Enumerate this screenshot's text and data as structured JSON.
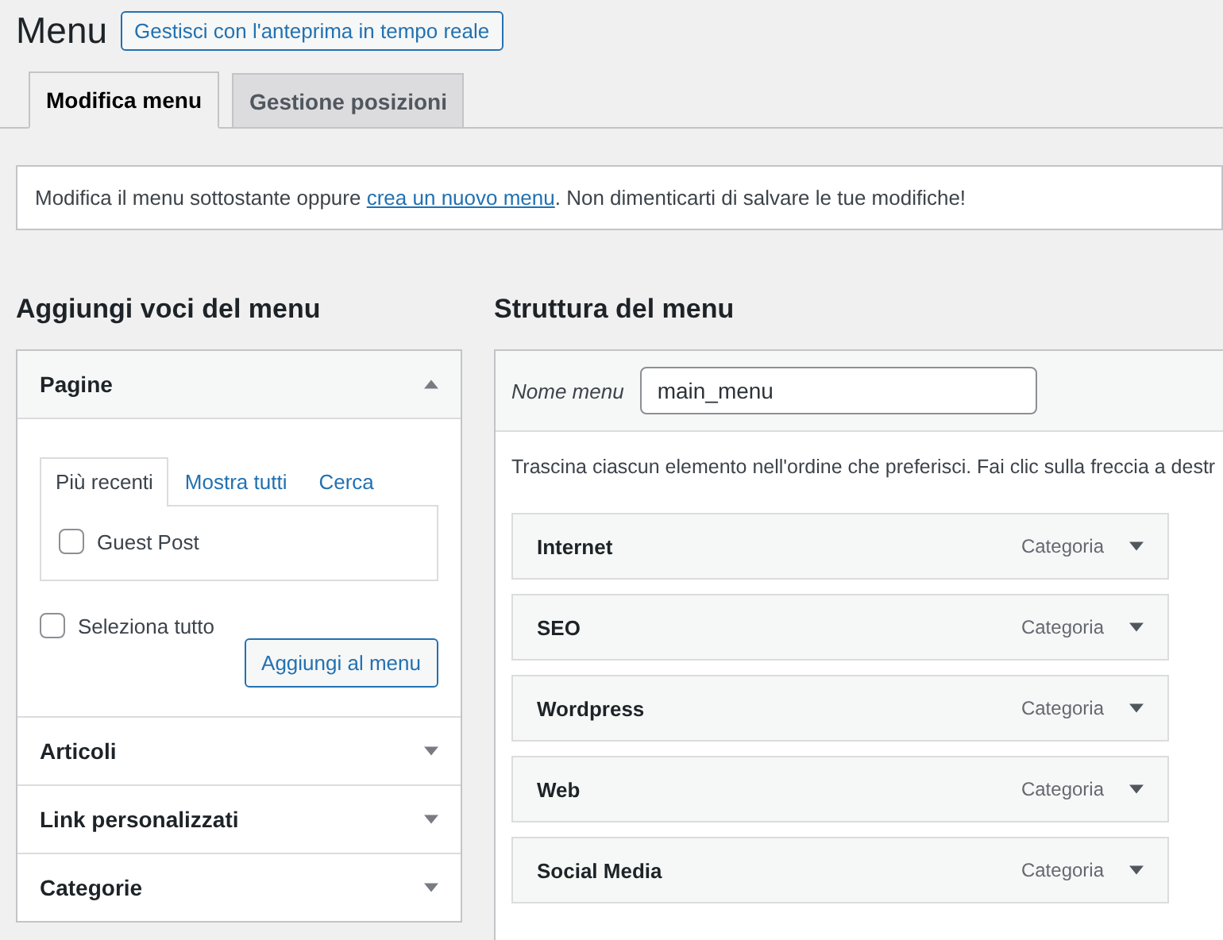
{
  "header": {
    "title": "Menu",
    "preview_button": "Gestisci con l'anteprima in tempo reale"
  },
  "tabs": [
    {
      "label": "Modifica menu",
      "selected": true
    },
    {
      "label": "Gestione posizioni",
      "selected": false
    }
  ],
  "notice": {
    "before": "Modifica il menu sottostante oppure ",
    "link": "crea un nuovo menu",
    "after": ". Non dimenticarti di salvare le tue modifiche!"
  },
  "add_items": {
    "title": "Aggiungi voci del menu",
    "sections": [
      {
        "title": "Pagine",
        "expanded": true,
        "tabs": [
          {
            "label": "Più recenti",
            "selected": true
          },
          {
            "label": "Mostra tutti",
            "selected": false
          },
          {
            "label": "Cerca",
            "selected": false
          }
        ],
        "items": [
          {
            "label": "Guest Post",
            "checked": false
          }
        ],
        "select_all": {
          "label": "Seleziona tutto",
          "checked": false
        },
        "button": "Aggiungi al menu"
      },
      {
        "title": "Articoli",
        "expanded": false
      },
      {
        "title": "Link personalizzati",
        "expanded": false
      },
      {
        "title": "Categorie",
        "expanded": false
      }
    ]
  },
  "structure": {
    "title": "Struttura del menu",
    "name_label": "Nome menu",
    "name_value": "main_menu",
    "instructions": "Trascina ciascun elemento nell'ordine che preferisci. Fai clic sulla freccia a destr",
    "items": [
      {
        "title": "Internet",
        "type": "Categoria"
      },
      {
        "title": "SEO",
        "type": "Categoria"
      },
      {
        "title": "Wordpress",
        "type": "Categoria"
      },
      {
        "title": "Web",
        "type": "Categoria"
      },
      {
        "title": "Social Media",
        "type": "Categoria"
      }
    ]
  }
}
